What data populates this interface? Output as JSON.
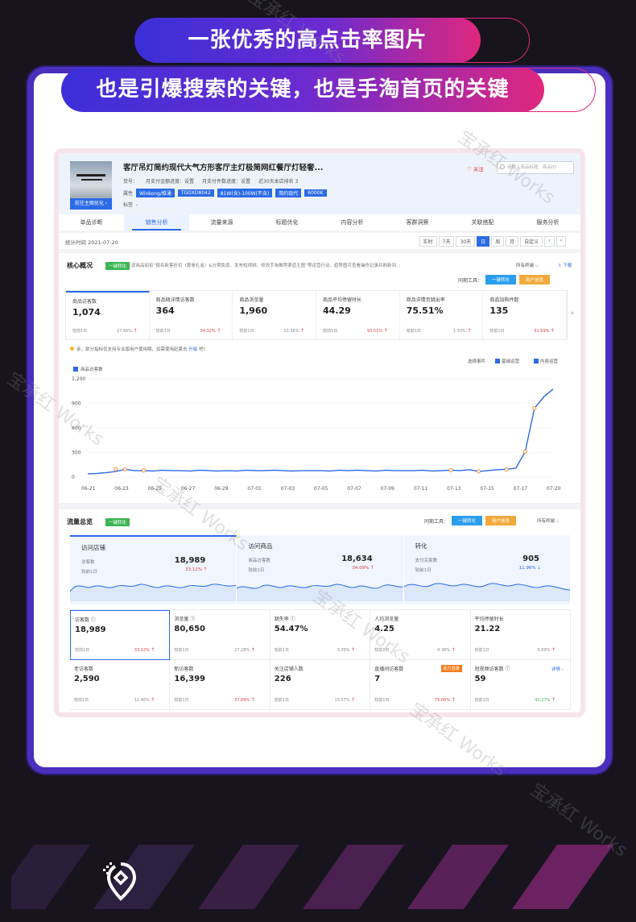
{
  "banners": {
    "line1": "一张优秀的高点击率图片",
    "line2": "也是引爆搜索的关键，也是手淘首页的关键"
  },
  "product": {
    "title": "客厅吊灯简约现代大气方形客厅主灯极简网红餐厅灯轻奢...",
    "goto_label": "前往主图优化 ›",
    "meta": [
      "货号：",
      "月支付金额进度：设置",
      "月支付件数进度：设置",
      "近30天本店排名 3"
    ],
    "attr_label": "属性",
    "tags": [
      "Winkong/维涌",
      "TGDXD8042",
      "81W(含)-100W(不含)",
      "简约现代",
      "6000K"
    ],
    "label_label": "标签",
    "label_value": "-",
    "follow": "♡ 关注",
    "search_placeholder": "请输入商品标题、商品ID"
  },
  "tabs": [
    "单品诊断",
    "销售分析",
    "流量来源",
    "标题优化",
    "内容分析",
    "客群洞察",
    "关联搭配",
    "服务分析"
  ],
  "active_tab": 1,
  "datebar": {
    "stat_time": "统计时间 2021-07-20",
    "buttons": [
      "实时",
      "7天",
      "30天",
      "日",
      "周",
      "月",
      "自定义",
      "‹",
      "›"
    ],
    "active_button": 3
  },
  "core": {
    "title": "核心概况",
    "convert_btn": "一键转化",
    "desc": "该商品如有“报名新客折扣（算单礼金）&分期免息、发布短视频、修改手淘推荐渠道主图”等运营行动，趋势图可查看操作记录并刷新到...",
    "all_types": "所有终端 ⌵",
    "download": "⇩ 下载",
    "tools_label": "同期工具：",
    "tool1": "一键转化",
    "tool2": "用户信息",
    "metrics": [
      {
        "label": "商品访客数",
        "value": "1,074",
        "compare": "较前1日",
        "pct": "27.66%",
        "red": false
      },
      {
        "label": "商品微详情访客数",
        "value": "364",
        "compare": "较前1日",
        "pct": "34.32%",
        "red": true
      },
      {
        "label": "商品浏览量",
        "value": "1,960",
        "compare": "较前1日",
        "pct": "10.36%",
        "red": false
      },
      {
        "label": "商品平均停留时长",
        "value": "44.29",
        "compare": "较前1日",
        "pct": "93.51%",
        "red": true
      },
      {
        "label": "商品详情页跳出率",
        "value": "75.51%",
        "compare": "较前1日",
        "pct": "1.33%",
        "red": false
      },
      {
        "label": "商品加购件数",
        "value": "135",
        "compare": "较前1日",
        "pct": "51.69%",
        "red": true
      }
    ],
    "notice_text": "亲，部分指标仅支持专业版用户使用哦，如需使用赶紧去",
    "notice_link": "升级",
    "notice_tail": "吧！",
    "check1": "选择事件",
    "check2": "基础运营",
    "check3": "内容运营",
    "legend": "商品访客数"
  },
  "chart_data": {
    "type": "line",
    "title": "",
    "series": [
      {
        "name": "商品访客数",
        "values": [
          40,
          45,
          55,
          70,
          95,
          80,
          80,
          75,
          85,
          80,
          80,
          75,
          85,
          80,
          75,
          80,
          75,
          85,
          80,
          80,
          85,
          80,
          75,
          80,
          80,
          80,
          75,
          85,
          80,
          85,
          80,
          75,
          85,
          80,
          80,
          80,
          85,
          75,
          80,
          85,
          80,
          90,
          70,
          80,
          90,
          95,
          110,
          310,
          840,
          980,
          1074
        ]
      }
    ],
    "x_labels": [
      "06-21",
      "06-23",
      "06-25",
      "06-27",
      "06-29",
      "07-01",
      "07-03",
      "07-05",
      "07-07",
      "07-09",
      "07-11",
      "07-13",
      "07-15",
      "07-17",
      "07-20"
    ],
    "markers": [
      {
        "x": 3,
        "y": 95
      },
      {
        "x": 4,
        "y": 95
      },
      {
        "x": 6,
        "y": 80
      },
      {
        "x": 39,
        "y": 85
      },
      {
        "x": 42,
        "y": 70
      },
      {
        "x": 45,
        "y": 95
      },
      {
        "x": 47,
        "y": 310
      },
      {
        "x": 48,
        "y": 840
      }
    ],
    "y_ticks": [
      0,
      300,
      600,
      900,
      1200
    ],
    "ylim": [
      0,
      1200
    ]
  },
  "traffic": {
    "title": "流量总览",
    "convert_btn": "一键转化",
    "tools_label": "同期工具：",
    "tool1": "一键转化",
    "tool2": "用户信息",
    "all_types": "所有终端 ⌵",
    "panels": [
      {
        "title": "访问店铺",
        "sub": "访客数",
        "value": "18,989",
        "compare": "较前1日",
        "pct": "33.12% ↑",
        "blue": false
      },
      {
        "title": "访问商品",
        "sub": "商品访客数",
        "value": "18,634",
        "compare": "较前1日",
        "pct": "34.09% ↑",
        "blue": false
      },
      {
        "title": "转化",
        "sub": "支付买家数",
        "value": "905",
        "compare": "较前1日",
        "pct": "11.96% ↓",
        "blue": true
      }
    ],
    "cells": [
      {
        "label": "访客数 ⓘ",
        "value": "18,989",
        "compare": "较前1日",
        "pct": "33.12%",
        "color": "red"
      },
      {
        "label": "浏览量 ⓘ",
        "value": "80,650",
        "compare": "较前1日",
        "pct": "27.28%",
        "color": ""
      },
      {
        "label": "跳失率 ⓘ",
        "value": "54.47%",
        "compare": "较前1日",
        "pct": "3.35%",
        "color": ""
      },
      {
        "label": "人均浏览量",
        "value": "4.25",
        "compare": "较前1日",
        "pct": "4.38%",
        "color": ""
      },
      {
        "label": "平均停留时长",
        "value": "21.22",
        "compare": "较前1日",
        "pct": "6.69%",
        "color": ""
      },
      {
        "label": "老访客数",
        "value": "2,590",
        "compare": "较前1日",
        "pct": "12.46%",
        "color": ""
      },
      {
        "label": "新访客数",
        "value": "16,399",
        "compare": "较前1日",
        "pct": "37.09%",
        "color": "red"
      },
      {
        "label": "关注店铺人数",
        "value": "226",
        "compare": "较前1日",
        "pct": "13.57%",
        "color": ""
      },
      {
        "label": "直播间访客数",
        "value": "7",
        "compare": "较前1日",
        "pct": "75.00%",
        "color": "red",
        "badge": "助力直播"
      },
      {
        "label": "短视频访客数 ⓘ",
        "value": "59",
        "compare": "较前1日",
        "pct": "43.27%",
        "color": "green",
        "more": "详情 ›"
      }
    ]
  },
  "watermark": "宝承红 Works",
  "colors": {
    "accent": "#2b6be6",
    "brand_grad_start": "#3b2fd8",
    "brand_grad_end": "#e0277e",
    "frame": "#4a2fbd"
  }
}
